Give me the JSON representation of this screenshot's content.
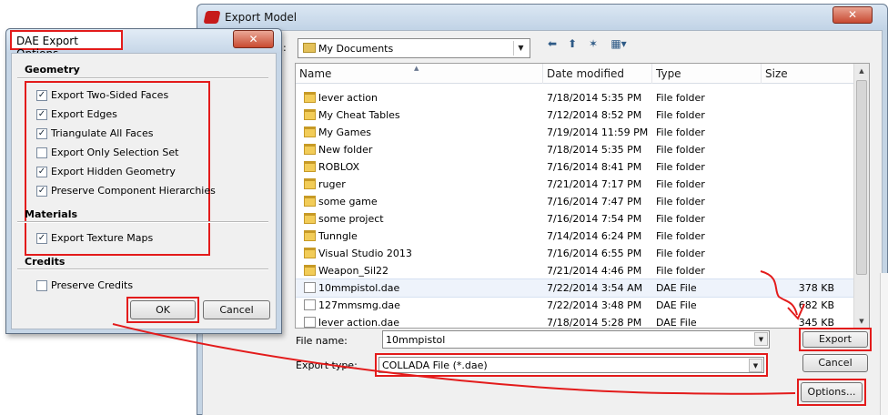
{
  "export_window": {
    "title": "Export Model",
    "close_glyph": "✕",
    "look_in": {
      "label": "n:",
      "value": "My Documents"
    },
    "columns": {
      "name": "Name",
      "date": "Date modified",
      "type": "Type",
      "size": "Size"
    },
    "rows": [
      {
        "name": "lever action",
        "date": "7/18/2014 5:35 PM",
        "type": "File folder",
        "size": "",
        "icon": "folder-icon"
      },
      {
        "name": "My Cheat Tables",
        "date": "7/12/2014 8:52 PM",
        "type": "File folder",
        "size": "",
        "icon": "folder-icon"
      },
      {
        "name": "My Games",
        "date": "7/19/2014 11:59 PM",
        "type": "File folder",
        "size": "",
        "icon": "folder-icon"
      },
      {
        "name": "New folder",
        "date": "7/18/2014 5:35 PM",
        "type": "File folder",
        "size": "",
        "icon": "folder-icon"
      },
      {
        "name": "ROBLOX",
        "date": "7/16/2014 8:41 PM",
        "type": "File folder",
        "size": "",
        "icon": "folder-icon"
      },
      {
        "name": "ruger",
        "date": "7/21/2014 7:17 PM",
        "type": "File folder",
        "size": "",
        "icon": "folder-icon"
      },
      {
        "name": "some game",
        "date": "7/16/2014 7:47 PM",
        "type": "File folder",
        "size": "",
        "icon": "folder-icon"
      },
      {
        "name": "some project",
        "date": "7/16/2014 7:54 PM",
        "type": "File folder",
        "size": "",
        "icon": "folder-icon"
      },
      {
        "name": "Tunngle",
        "date": "7/14/2014 6:24 PM",
        "type": "File folder",
        "size": "",
        "icon": "folder-icon"
      },
      {
        "name": "Visual Studio 2013",
        "date": "7/16/2014 6:55 PM",
        "type": "File folder",
        "size": "",
        "icon": "folder-icon"
      },
      {
        "name": "Weapon_Sil22",
        "date": "7/21/2014 4:46 PM",
        "type": "File folder",
        "size": "",
        "icon": "folder-icon"
      },
      {
        "name": "10mmpistol.dae",
        "date": "7/22/2014 3:54 AM",
        "type": "DAE File",
        "size": "378 KB",
        "icon": "file-icon"
      },
      {
        "name": "127mmsmg.dae",
        "date": "7/22/2014 3:48 PM",
        "type": "DAE File",
        "size": "682 KB",
        "icon": "file-icon"
      },
      {
        "name": "lever action.dae",
        "date": "7/18/2014 5:28 PM",
        "type": "DAE File",
        "size": "345 KB",
        "icon": "file-icon"
      }
    ],
    "file_name": {
      "label": "File name:",
      "value": "10mmpistol"
    },
    "export_type": {
      "label": "Export type:",
      "value": "COLLADA File (*.dae)"
    },
    "buttons": {
      "export": "Export",
      "cancel": "Cancel",
      "options": "Options..."
    }
  },
  "dae_dialog": {
    "title": "DAE Export Options",
    "close_glyph": "✕",
    "sections": {
      "geometry": "Geometry",
      "materials": "Materials",
      "credits": "Credits"
    },
    "geometry_options": [
      {
        "label": "Export Two-Sided Faces",
        "checked": true
      },
      {
        "label": "Export Edges",
        "checked": true
      },
      {
        "label": "Triangulate All Faces",
        "checked": true
      },
      {
        "label": "Export Only Selection Set",
        "checked": false
      },
      {
        "label": "Export Hidden Geometry",
        "checked": true
      },
      {
        "label": "Preserve Component Hierarchies",
        "checked": true
      }
    ],
    "material_options": [
      {
        "label": "Export Texture Maps",
        "checked": true
      }
    ],
    "credit_options": [
      {
        "label": "Preserve Credits",
        "checked": false
      }
    ],
    "buttons": {
      "ok": "OK",
      "cancel": "Cancel"
    }
  },
  "colors": {
    "annotation_red": "#e31b1b",
    "titlebar_blue": "#c4d4e4",
    "close_red": "#c84a32"
  },
  "icons": {
    "back": "back-arrow-icon",
    "up": "up-folder-icon",
    "new_folder": "new-folder-icon",
    "views": "views-menu-icon"
  }
}
